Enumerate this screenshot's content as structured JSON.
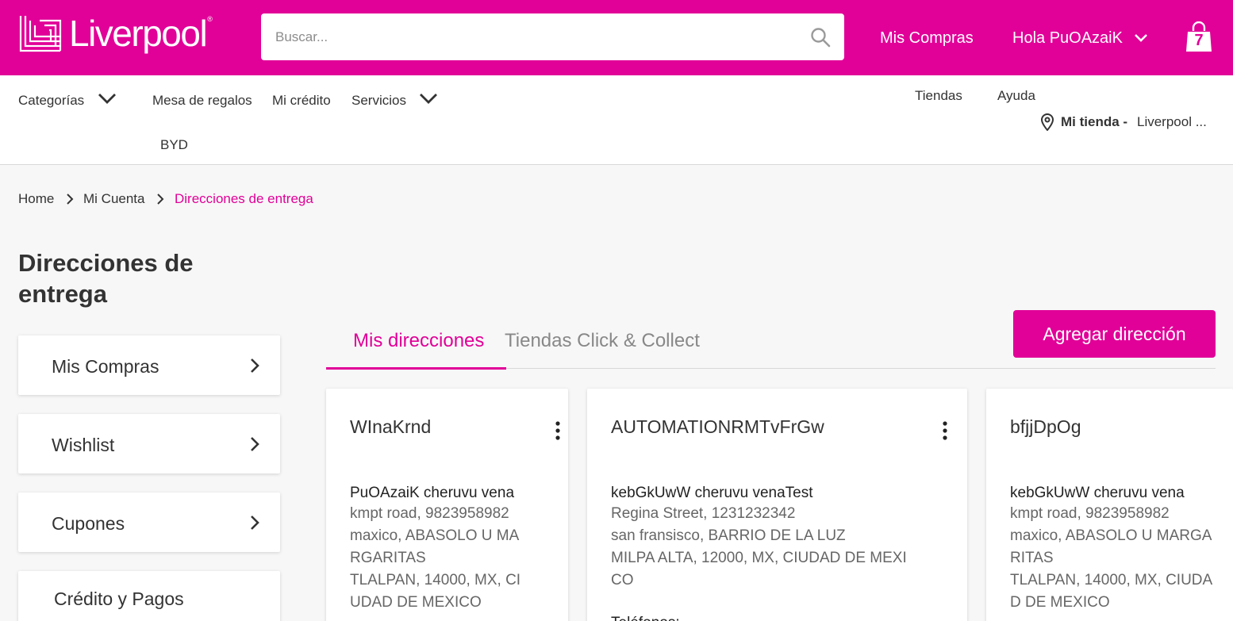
{
  "header": {
    "logo_text": "Liverpool",
    "logo_reg": "®",
    "search_placeholder": "Buscar...",
    "mis_compras": "Mis Compras",
    "greeting": "Hola PuOAzaiK",
    "cart_count": "7",
    "brand_color": "#e10098"
  },
  "nav": {
    "categorias": "Categorías",
    "mesa_regalos": "Mesa de regalos",
    "mi_credito": "Mi crédito",
    "servicios": "Servicios",
    "byd": "BYD",
    "tiendas": "Tiendas",
    "ayuda": "Ayuda",
    "mi_tienda_label": "Mi tienda -",
    "mi_tienda_value": "Liverpool ..."
  },
  "breadcrumb": {
    "home": "Home",
    "mi_cuenta": "Mi Cuenta",
    "current": "Direcciones de entrega"
  },
  "page_title": "Direcciones de entrega",
  "side_menu": [
    {
      "label": "Mis Compras"
    },
    {
      "label": "Wishlist"
    },
    {
      "label": "Cupones"
    },
    {
      "label": "Crédito y Pagos"
    }
  ],
  "tabs": {
    "active": "Mis direcciones",
    "inactive": "Tiendas Click & Collect"
  },
  "add_button": "Agregar dirección",
  "addresses": [
    {
      "alias": "WInaKrnd",
      "name": "PuOAzaiK cheruvu vena",
      "lines": [
        "kmpt road, 9823958982",
        "maxico, ABASOLO U MA",
        "RGARITAS",
        "TLALPAN, 14000, MX, CI",
        "UDAD DE MEXICO"
      ]
    },
    {
      "alias": "AUTOMATIONRMTvFrGw",
      "name": "kebGkUwW cheruvu venaTest",
      "lines": [
        "Regina Street, 1231232342",
        "san fransisco, BARRIO DE LA LUZ",
        "MILPA ALTA, 12000, MX, CIUDAD DE MEXI",
        "CO"
      ],
      "phone_label": "Teléfonos:"
    },
    {
      "alias": "bfjjDpOg",
      "name": "kebGkUwW cheruvu vena",
      "lines": [
        "kmpt road, 9823958982",
        "maxico, ABASOLO U MARGA",
        "RITAS",
        "TLALPAN, 14000, MX, CIUDA",
        "D DE MEXICO"
      ]
    }
  ]
}
